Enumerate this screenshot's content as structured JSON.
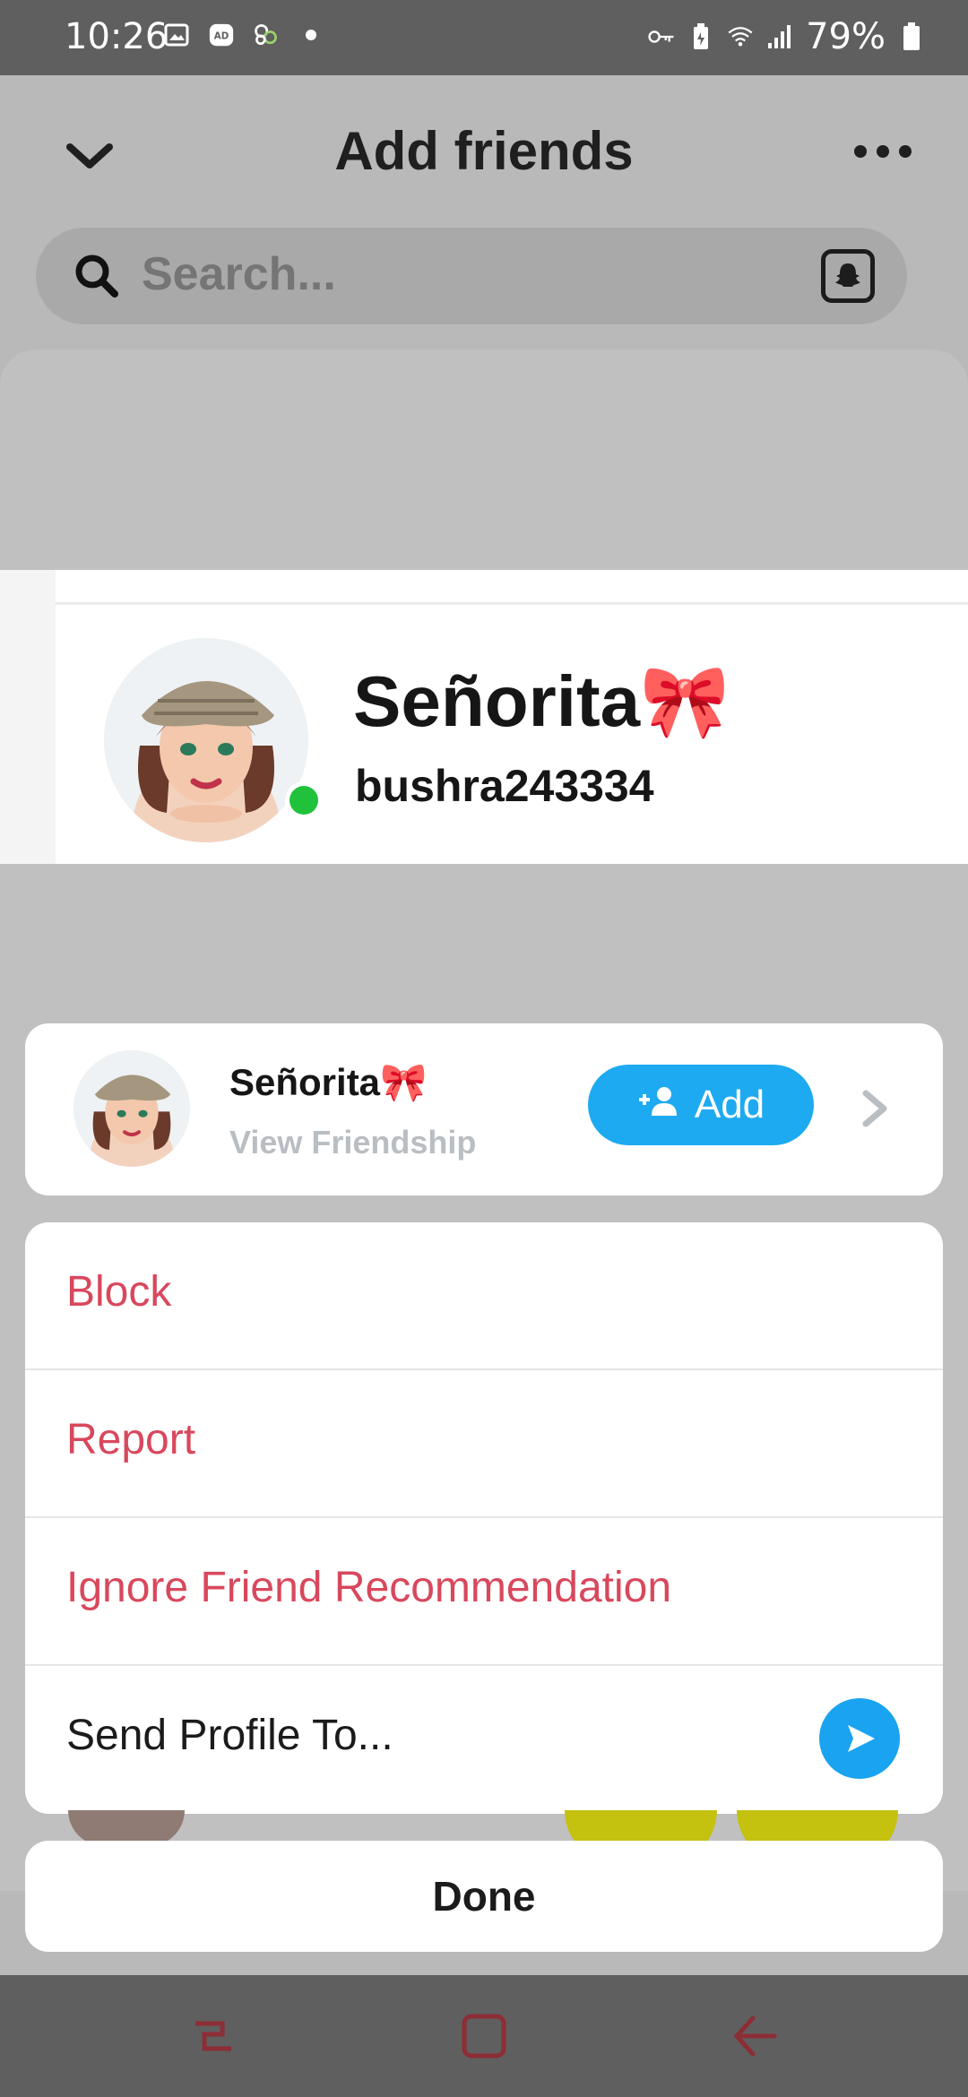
{
  "status_bar": {
    "time": "10:26",
    "battery": "79%",
    "left_icons": [
      "image-icon",
      "ad-blocker-icon",
      "app-icon",
      "dot-icon"
    ],
    "right_icons": [
      "key-icon",
      "battery-saver-icon",
      "wifi-icon",
      "signal-icon",
      "battery-icon"
    ]
  },
  "header": {
    "title": "Add friends",
    "back_icon": "chevron-down-icon",
    "more_icon": "more-icon"
  },
  "search": {
    "placeholder": "Search...",
    "right_icon": "snapchat-ghost-icon"
  },
  "preview_profile": {
    "display_name": "Señorita🎀",
    "username": "bushra243334",
    "online": true
  },
  "sheet_header": {
    "display_name": "Señorita🎀",
    "subtitle": "View Friendship",
    "add_label": "Add"
  },
  "menu": {
    "items": [
      {
        "label": "Block",
        "style": "danger"
      },
      {
        "label": "Report",
        "style": "danger"
      },
      {
        "label": "Ignore Friend Recommendation",
        "style": "danger"
      },
      {
        "label": "Send Profile To...",
        "style": "plain"
      }
    ]
  },
  "done_label": "Done",
  "colors": {
    "accent_blue": "#1eaaf1",
    "danger_red": "#d8485d",
    "online_green": "#20c23c",
    "status_bar": "#5f5f5f"
  }
}
